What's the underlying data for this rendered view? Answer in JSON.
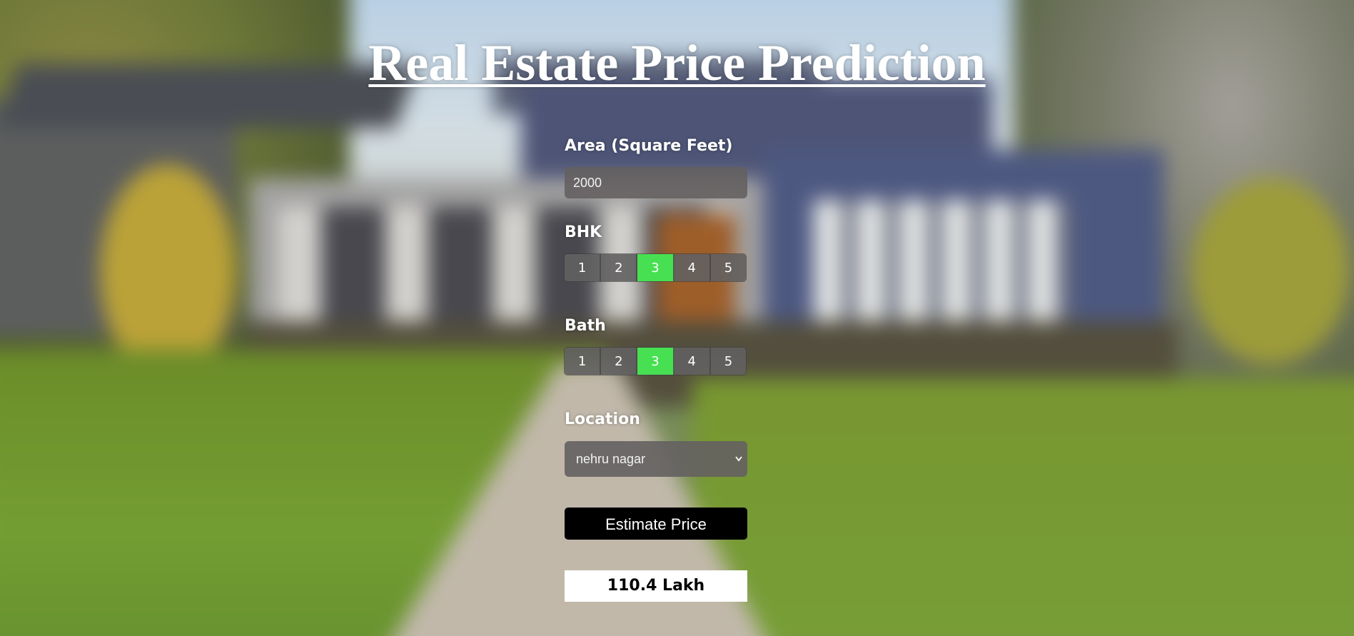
{
  "page": {
    "title": "Real Estate Price Prediction"
  },
  "form": {
    "area": {
      "label": "Area (Square Feet)",
      "value": "2000"
    },
    "bhk": {
      "label": "BHK",
      "options": [
        "1",
        "2",
        "3",
        "4",
        "5"
      ],
      "selected": "3"
    },
    "bath": {
      "label": "Bath",
      "options": [
        "1",
        "2",
        "3",
        "4",
        "5"
      ],
      "selected": "3"
    },
    "location": {
      "label": "Location",
      "selected": "nehru nagar"
    },
    "estimate_button": "Estimate Price",
    "result": "110.4 Lakh"
  },
  "colors": {
    "active_option": "#47e052",
    "button_bg": "#000000",
    "result_bg": "#ffffff"
  },
  "icons": {
    "location_dropdown": "chevron-down-icon"
  }
}
